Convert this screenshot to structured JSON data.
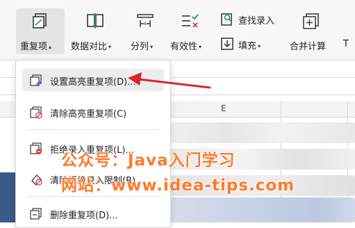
{
  "ribbon": {
    "duplicates": "重复项",
    "compare": "数据对比",
    "split": "分列",
    "validity": "有效性",
    "find_entry": "查找录入",
    "fill": "填充",
    "merge_calc": "合并计算",
    "partial_next": "T"
  },
  "sheet": {
    "column_e": "E"
  },
  "menu": {
    "items": [
      {
        "label": "设置高亮重复项(D)...",
        "icon": "highlight-duplicates-icon"
      },
      {
        "label": "清除高亮重复项(C)",
        "icon": "clear-highlight-icon"
      },
      {
        "label": "拒绝录入重复项(L)...",
        "icon": "reject-entry-icon"
      },
      {
        "label": "清除拒绝录入限制(R)",
        "icon": "clear-restriction-icon"
      },
      {
        "label": "删除重复项(D)...",
        "icon": "delete-duplicates-icon"
      }
    ]
  },
  "watermark": {
    "line1": "公众号：Java入门学习",
    "line2": "网站：www.idea-tips.com"
  },
  "colors": {
    "watermark": "#ff7a2a",
    "arrow": "#d9262b",
    "highlight": "#ececec",
    "accent_green": "#1e9e54",
    "accent_red": "#d33b3b"
  }
}
